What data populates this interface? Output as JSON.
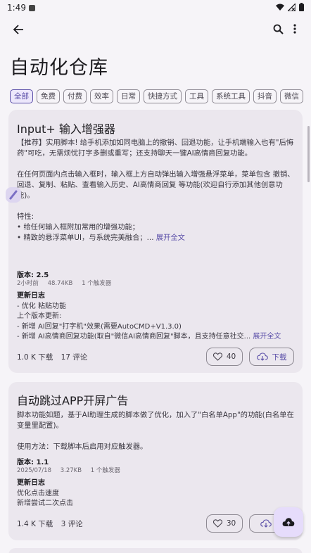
{
  "status_bar": {
    "time": "1:49",
    "icons": [
      "notification-icon",
      "wifi-icon",
      "no-signal-icon",
      "battery-icon"
    ]
  },
  "toolbar": {
    "back_icon": "arrow-left-icon",
    "search_icon": "search-icon",
    "more_icon": "more-vertical-icon"
  },
  "page_title": "自动化仓库",
  "chips": [
    {
      "label": "全部",
      "active": true
    },
    {
      "label": "免费",
      "active": false
    },
    {
      "label": "付费",
      "active": false
    },
    {
      "label": "效率",
      "active": false
    },
    {
      "label": "日常",
      "active": false
    },
    {
      "label": "快捷方式",
      "active": false
    },
    {
      "label": "工具",
      "active": false
    },
    {
      "label": "系统工具",
      "active": false
    },
    {
      "label": "抖音",
      "active": false
    },
    {
      "label": "微信",
      "active": false
    }
  ],
  "cards": [
    {
      "title": "Input+ 输入增强器",
      "description": [
        "【推荐】实用脚本! 给手机添加如同电脑上的撤销、回退功能，让手机端输入也有\"后悔药\"可吃，无需烦忧打字多删或重写；还支持聊天一键AI高情商回复功能。",
        "在任何页面内点击输入框时，输入框上方自动弹出输入增强悬浮菜单，菜单包含 撤销、回退、复制、粘贴、查看输入历史、AI高情商回复 等功能(欢迎自行添加其他创意功能)。",
        "特性:",
        "• 给任何输入框附加常用的增强功能；",
        "• 精致的悬浮菜单UI，与系统完美融合；..."
      ],
      "expand_label": "展开全文",
      "version_label": "版本: 2.5",
      "meta": [
        "2小时前",
        "48.74KB",
        "1 个触发器"
      ],
      "changelog_title": "更新日志",
      "changelog": [
        "- 优化 粘贴功能",
        "上个版本更新:",
        "- 新增 AI回复\"打字机\"效果(需要AutoCMD+V1.3.0)",
        "- 新增 AI高情商回复功能(取自\"微信AI高情商回复\"脚本，且支持任意社交..."
      ],
      "changelog_expand": "展开全文",
      "downloads": "1.0 K 下载",
      "comments": "17 评论",
      "likes": "40",
      "download_label": "下载"
    },
    {
      "title": "自动跳过APP开屏广告",
      "description": [
        "脚本功能如题，基于AI助理生成的脚本做了优化，加入了\"白名单App\"的功能(白名单在变量里配置)。",
        "使用方法：下载脚本后启用对应触发器。"
      ],
      "version_label": "版本: 1.1",
      "meta": [
        "2025/07/18",
        "3.27KB",
        "1 个触发器"
      ],
      "changelog_title": "更新日志",
      "changelog": [
        "优化点击速度",
        "新增尝试二次点击"
      ],
      "downloads": "1.4 K 下载",
      "comments": "3 评论",
      "likes": "30",
      "download_label": "下"
    }
  ],
  "fab_icon": "cloud-upload-icon",
  "side_handle_icon": "edit-handle-icon",
  "colors": {
    "accent": "#5a4ea8",
    "background": "#f6f4f8",
    "card": "#ebe7ee",
    "fab": "#e6dcfb"
  }
}
